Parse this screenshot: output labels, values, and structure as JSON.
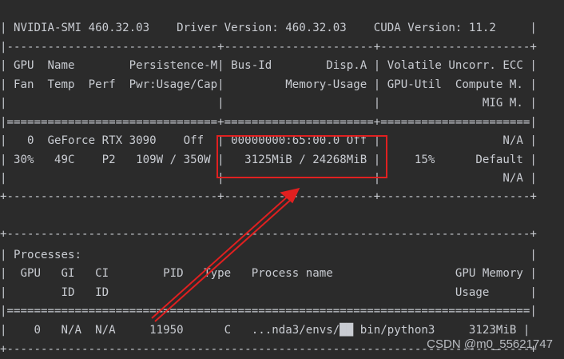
{
  "terminal": {
    "lines": [
      "| NVIDIA-SMI 460.32.03    Driver Version: 460.32.03    CUDA Version: 11.2     |",
      "|-------------------------------+----------------------+----------------------+",
      "| GPU  Name        Persistence-M| Bus-Id        Disp.A | Volatile Uncorr. ECC |",
      "| Fan  Temp  Perf  Pwr:Usage/Cap|         Memory-Usage | GPU-Util  Compute M. |",
      "|                               |                      |               MIG M. |",
      "|===============================+======================+======================|",
      "|   0  GeForce RTX 3090    Off  | 00000000:65:00.0 Off |                  N/A |",
      "| 30%   49C    P2   109W / 350W |   3125MiB / 24268MiB |     15%      Default |",
      "|                               |                      |                  N/A |",
      "+-------------------------------+----------------------+----------------------+",
      "",
      "",
      "+-----------------------------------------------------------------------------+",
      "| Processes:                                                                  |",
      "|  GPU   GI   CI        PID   Type   Process name                  GPU Memory |",
      "|        ID   ID                                                   Usage      |",
      "|=============================================================================|",
      "|    0   N/A  N/A     11950      C   ...nda3/envs/██ bin/python3     3123MiB |",
      "+-----------------------------------------------------------------------------+"
    ]
  },
  "annotation": {
    "color": "#e02020"
  },
  "watermark": "CSDN @m0_55621747"
}
